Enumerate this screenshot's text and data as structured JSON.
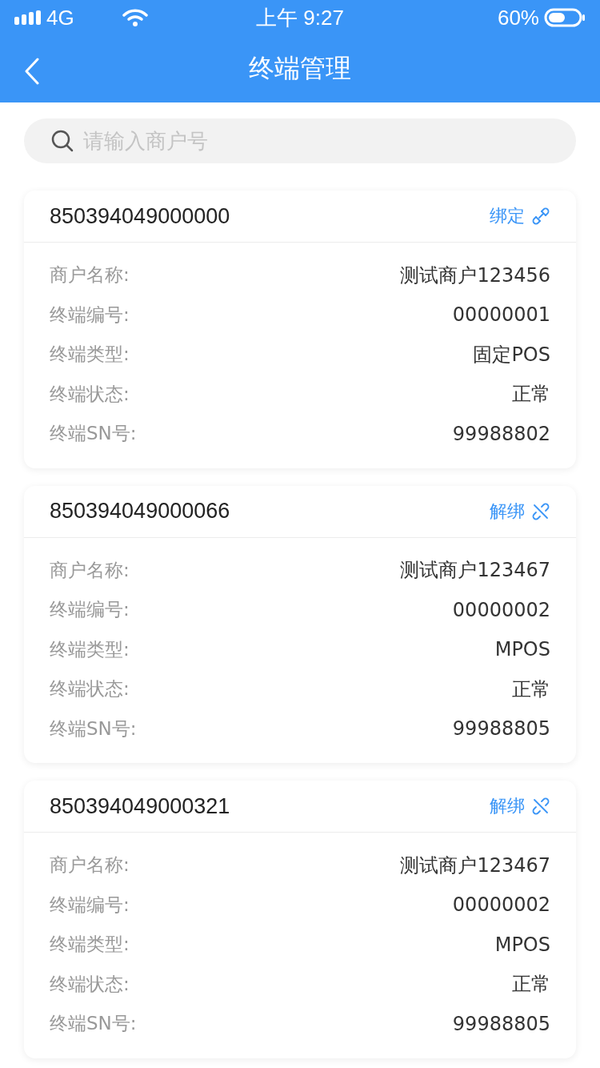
{
  "status_bar": {
    "carrier": "4G",
    "time": "上午 9:27",
    "battery": "60%"
  },
  "nav": {
    "title": "终端管理"
  },
  "search": {
    "placeholder": "请输入商户号"
  },
  "cards": [
    {
      "id": "850394049000000",
      "action": {
        "kind": "bind",
        "label": "绑定"
      },
      "fields": [
        {
          "label": "商户名称:",
          "value": "测试商户123456"
        },
        {
          "label": "终端编号:",
          "value": "00000001"
        },
        {
          "label": "终端类型:",
          "value": "固定POS"
        },
        {
          "label": "终端状态:",
          "value": "正常"
        },
        {
          "label": "终端SN号:",
          "value": "99988802"
        }
      ]
    },
    {
      "id": "850394049000066",
      "action": {
        "kind": "unbind",
        "label": "解绑"
      },
      "fields": [
        {
          "label": "商户名称:",
          "value": "测试商户123467"
        },
        {
          "label": "终端编号:",
          "value": "00000002"
        },
        {
          "label": "终端类型:",
          "value": "MPOS"
        },
        {
          "label": "终端状态:",
          "value": "正常"
        },
        {
          "label": "终端SN号:",
          "value": "99988805"
        }
      ]
    },
    {
      "id": "850394049000321",
      "action": {
        "kind": "unbind",
        "label": "解绑"
      },
      "fields": [
        {
          "label": "商户名称:",
          "value": "测试商户123467"
        },
        {
          "label": "终端编号:",
          "value": "00000002"
        },
        {
          "label": "终端类型:",
          "value": "MPOS"
        },
        {
          "label": "终端状态:",
          "value": "正常"
        },
        {
          "label": "终端SN号:",
          "value": "99988805"
        }
      ]
    }
  ]
}
